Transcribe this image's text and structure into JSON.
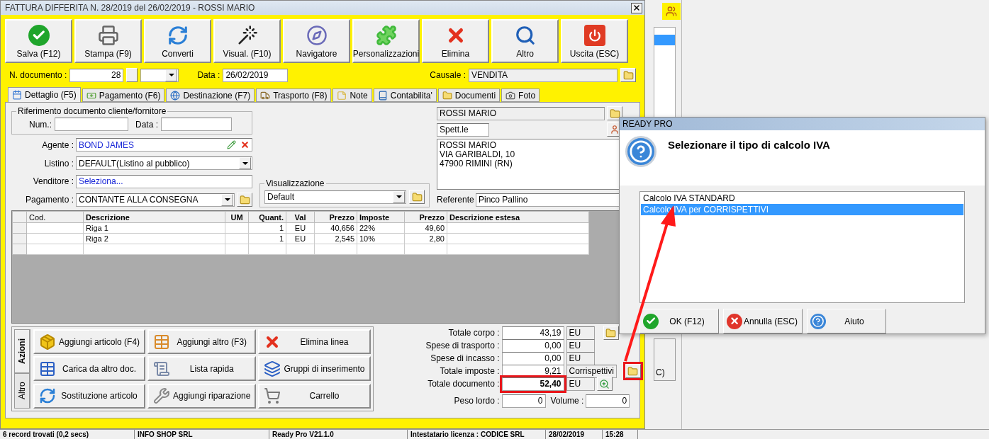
{
  "window": {
    "title": "FATTURA DIFFERITA N. 28/2019 del 26/02/2019 - ROSSI MARIO"
  },
  "toolbar": [
    {
      "label": "Salva (F12)",
      "kind": "save"
    },
    {
      "label": "Stampa (F9)",
      "kind": "print"
    },
    {
      "label": "Converti",
      "kind": "convert"
    },
    {
      "label": "Visual. (F10)",
      "kind": "wand"
    },
    {
      "label": "Navigatore",
      "kind": "compass"
    },
    {
      "label": "Personalizzazioni",
      "kind": "puzzle"
    },
    {
      "label": "Elimina",
      "kind": "delete"
    },
    {
      "label": "Altro",
      "kind": "search"
    },
    {
      "label": "Uscita (ESC)",
      "kind": "power"
    }
  ],
  "document": {
    "number_label": "N. documento :",
    "number": "28",
    "date_label": "Data :",
    "date": "26/02/2019",
    "causale_label": "Causale :",
    "causale": "VENDITA"
  },
  "tabs": [
    {
      "label": "Dettaglio (F5)",
      "kind": "calendar",
      "selected": true
    },
    {
      "label": "Pagamento (F6)",
      "kind": "money",
      "selected": false
    },
    {
      "label": "Destinazione (F7)",
      "kind": "globe",
      "selected": false
    },
    {
      "label": "Trasporto (F8)",
      "kind": "truck",
      "selected": false
    },
    {
      "label": "Note",
      "kind": "note",
      "selected": false
    },
    {
      "label": "Contabilita'",
      "kind": "book",
      "selected": false
    },
    {
      "label": "Documenti",
      "kind": "folder",
      "selected": false
    },
    {
      "label": "Foto",
      "kind": "camera",
      "selected": false
    }
  ],
  "reference": {
    "legend": "Riferimento documento cliente/fornitore",
    "num_label": "Num.:",
    "date_label": "Data :"
  },
  "fields": [
    {
      "label": "Agente :",
      "value": "BOND JAMES",
      "kind": "agent"
    },
    {
      "label": "Listino :",
      "value": "DEFAULT(Listino al pubblico)",
      "kind": "dropdown"
    },
    {
      "label": "Venditore :",
      "value": "Seleziona...",
      "kind": "link"
    },
    {
      "label": "Pagamento :",
      "value": "CONTANTE ALLA CONSEGNA",
      "kind": "dropdown-folder"
    }
  ],
  "view": {
    "legend": "Visualizzazione",
    "value": "Default"
  },
  "customer": {
    "name": "ROSSI MARIO",
    "salutation": "Spett.le",
    "address": [
      "ROSSI MARIO",
      "VIA GARIBALDI, 10",
      "47900 RIMINI (RN)"
    ],
    "referente_label": "Referente",
    "referente": "Pinco Pallino"
  },
  "table": {
    "columns": [
      {
        "label": "Cod.",
        "bold": false
      },
      {
        "label": "Descrizione",
        "bold": true
      },
      {
        "label": "UM",
        "bold": true
      },
      {
        "label": "Quant.",
        "bold": true
      },
      {
        "label": "Val",
        "bold": true
      },
      {
        "label": "Prezzo",
        "bold": true
      },
      {
        "label": "Imposte",
        "bold": true
      },
      {
        "label": "Prezzo",
        "bold": true
      },
      {
        "label": "Descrizione estesa",
        "bold": true
      }
    ],
    "rows": [
      {
        "descrizione": "Riga 1",
        "quant": "1",
        "val": "EU",
        "prezzo": "40,656",
        "imposte": "22%",
        "prezzo_ivato": "49,60"
      },
      {
        "descrizione": "Riga 2",
        "quant": "1",
        "val": "EU",
        "prezzo": "2,545",
        "imposte": "10%",
        "prezzo_ivato": "2,80"
      }
    ]
  },
  "action_tabs": [
    {
      "label": "Azioni",
      "selected": true
    },
    {
      "label": "Altro",
      "selected": false
    }
  ],
  "actions": [
    {
      "label": "Aggiungi articolo (F4)",
      "kind": "box-add"
    },
    {
      "label": "Aggiungi altro (F3)",
      "kind": "grid-add"
    },
    {
      "label": "Elimina linea",
      "kind": "delete"
    },
    {
      "label": "Carica da altro doc.",
      "kind": "grid-check"
    },
    {
      "label": "Lista rapida",
      "kind": "scroll-add"
    },
    {
      "label": "Gruppi di inserimento",
      "kind": "layers-add"
    },
    {
      "label": "Sostituzione articolo",
      "kind": "convert"
    },
    {
      "label": "Aggiungi riparazione",
      "kind": "wrench"
    },
    {
      "label": "Carrello",
      "kind": "cart"
    }
  ],
  "totals": [
    {
      "label": "Totale corpo :",
      "value": "43,19",
      "unit": "EU",
      "kind": "folder",
      "bold": false,
      "highlighted": false
    },
    {
      "label": "Spese di trasporto :",
      "value": "0,00",
      "unit": "EU",
      "kind": "plain",
      "bold": false,
      "highlighted": false
    },
    {
      "label": "Spese di incasso :",
      "value": "0,00",
      "unit": "EU",
      "kind": "plain",
      "bold": false,
      "highlighted": false
    },
    {
      "label": "Totale imposte :",
      "value": "9,21",
      "unit": "Corrispettivi",
      "kind": "folder",
      "bold": false,
      "highlighted": true
    },
    {
      "label": "Totale documento :",
      "value": "52,40",
      "unit": "EU",
      "kind": "zoom",
      "bold": true,
      "highlighted": true
    }
  ],
  "weight": {
    "label": "Peso lordo :",
    "value": "0"
  },
  "volume": {
    "label": "Volume :",
    "value": "0"
  },
  "dialog": {
    "title": "READY PRO",
    "message": "Selezionare il tipo di calcolo IVA",
    "options": [
      {
        "label": "Calcolo IVA STANDARD",
        "selected": false
      },
      {
        "label": "Calcolo IVA per CORRISPETTIVI",
        "selected": true
      }
    ],
    "buttons": [
      {
        "label": "OK (F12)",
        "kind": "ok"
      },
      {
        "label": "Annulla (ESC)",
        "kind": "cancel"
      },
      {
        "label": "Aiuto",
        "kind": "help"
      }
    ]
  },
  "background_window": {
    "button_fragment": "C)"
  },
  "status_bar": [
    "6 record trovati (0,2 secs)",
    "INFO SHOP SRL",
    "Ready Pro V21.1.0",
    "Intestatario licenza : CODICE SRL",
    "28/02/2019",
    "15:28"
  ]
}
